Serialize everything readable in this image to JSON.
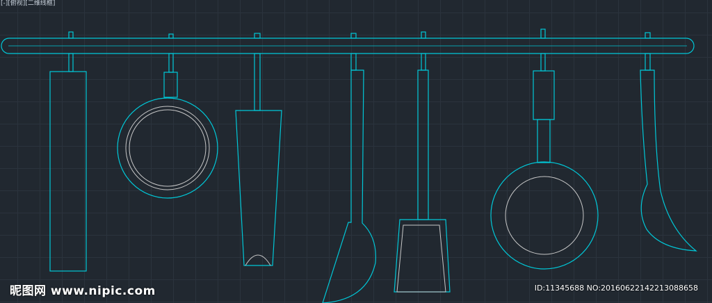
{
  "view_controls": {
    "prefix": "[-]",
    "view": "[俯视]",
    "visual_style": "[二维线框]"
  },
  "colors": {
    "background": "#212830",
    "grid": "#2b333d",
    "line_cyan": "#00c8d8",
    "line_white": "#c8c8c8"
  },
  "watermark": {
    "logo": "昵图网 www.nipic.com",
    "id_text": "ID:11345688 NO:20160622142213088658"
  }
}
